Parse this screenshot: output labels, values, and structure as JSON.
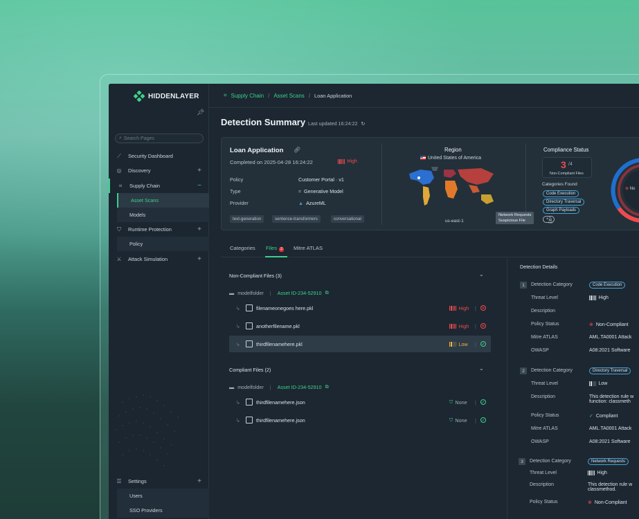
{
  "brand": {
    "name": "HIDDENLAYER",
    "accent": "#3fd08a"
  },
  "sidebar": {
    "search_placeholder": "Search Pages",
    "items": [
      {
        "label": "Security Dashboard",
        "icon": "chart-line-icon"
      },
      {
        "label": "Discovery",
        "icon": "globe-icon"
      },
      {
        "label": "Supply Chain",
        "icon": "scan-icon"
      },
      {
        "label": "Runtime Protection",
        "icon": "shield-icon"
      },
      {
        "label": "Attack Simulation",
        "icon": "sword-icon"
      },
      {
        "label": "Settings",
        "icon": "sliders-icon"
      }
    ],
    "supply_chain_children": [
      "Asset Scans",
      "Models"
    ],
    "runtime_children": [
      "Policy"
    ],
    "settings_children": [
      "Users",
      "SSO Providers"
    ]
  },
  "breadcrumb": {
    "items": [
      "Supply Chain",
      "Asset Scans",
      "Loan Application"
    ]
  },
  "page": {
    "title": "Detection Summary",
    "updated": "Last updated 16:24:22"
  },
  "summary": {
    "name": "Loan Application",
    "completed": "Completed on  2025-04-28  16:24:22",
    "severity": "High",
    "policy_label": "Policy",
    "policy_value": "Customer Portal  ·  v1",
    "type_label": "Type",
    "type_value": "Generative Model",
    "provider_label": "Provider",
    "provider_value": "AzureML",
    "tags": [
      "text-generation",
      "sentence-transformers",
      "conversational"
    ],
    "region_title": "Region",
    "region_country": "United States of America",
    "region_code": "us-east-1",
    "compliance_title": "Compliance Status",
    "noncompliant_count": "3",
    "noncompliant_total": "/4",
    "noncompliant_label": "Non-Compliant Files",
    "categories_label": "Categories Found",
    "categories": [
      "Code Execution",
      "Directory Traversal",
      "Graph Payloads"
    ],
    "more": "+2",
    "tooltip": [
      "Network Requests",
      "Suspicious File"
    ],
    "gauge_label": "No"
  },
  "tabs": {
    "categories": "Categories",
    "files": "Files",
    "files_count": "2",
    "mitre": "Mitre ATLAS"
  },
  "files": {
    "noncompliant_header": "Non-Compliant Files (3)",
    "compliant_header": "Compliant Files (2)",
    "folder": "modelfolder",
    "asset_id": "Asset ID-234-52910",
    "noncompliant": [
      {
        "name": "filenameonegoes here.pkl",
        "level": "High"
      },
      {
        "name": "anotherfilename.pkl",
        "level": "High"
      },
      {
        "name": "thirdfilenamehere.pkl",
        "level": "Low"
      }
    ],
    "compliant": [
      {
        "name": "thirdfilenamehere.json",
        "level": "None"
      },
      {
        "name": "thirdfilenamehere.json",
        "level": "None"
      }
    ]
  },
  "details": {
    "header": "Detection Details",
    "labels": {
      "category": "Detection Category",
      "threat": "Threat Level",
      "description": "Description",
      "policy": "Policy Status",
      "mitre": "Mitre ATLAS",
      "owasp": "OWASP"
    },
    "items": [
      {
        "n": "1",
        "category": "Code Execution",
        "threat": "High",
        "description": "",
        "policy": "Non-Compliant",
        "mitre": "AML.TA0001 Attack",
        "owasp": "A08:2021 Software"
      },
      {
        "n": "2",
        "category": "Directory Traversal",
        "threat": "Low",
        "description": "This detection rule w",
        "description2": "function: classmeth",
        "policy": "Compliant",
        "mitre": "AML.TA0001 Attack",
        "owasp": "A08:2021 Software"
      },
      {
        "n": "3",
        "category": "Network Requests",
        "threat": "High",
        "description": "This detection rule w",
        "description2": "classmethod.",
        "policy": "Non-Compliant"
      }
    ]
  }
}
